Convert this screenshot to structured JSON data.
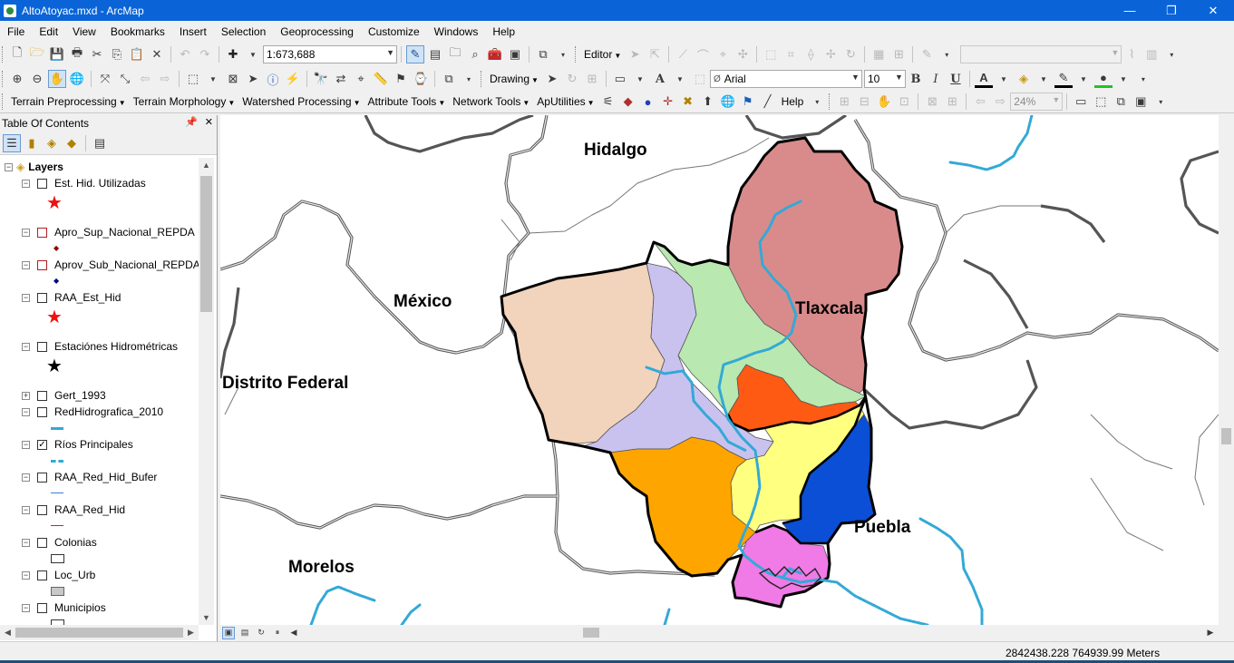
{
  "window": {
    "title": "AltoAtoyac.mxd - ArcMap",
    "controls": [
      "—",
      "❐",
      "✕"
    ]
  },
  "menu": [
    "File",
    "Edit",
    "View",
    "Bookmarks",
    "Insert",
    "Selection",
    "Geoprocessing",
    "Customize",
    "Windows",
    "Help"
  ],
  "toolbar1": {
    "scale": "1:673,688",
    "editor_label": "Editor"
  },
  "toolbar2": {
    "drawing_label": "Drawing",
    "font_name": "Arial",
    "font_size": "10",
    "bold": "B",
    "italic": "I",
    "underline": "U",
    "text_tool": "A"
  },
  "toolbar3": {
    "items": [
      "Terrain Preprocessing",
      "Terrain Morphology",
      "Watershed Processing",
      "Attribute Tools",
      "Network Tools",
      "ApUtilities"
    ],
    "help_label": "Help",
    "zoom_percent": "24%"
  },
  "toc": {
    "title": "Table Of Contents",
    "root": "Layers",
    "layers": [
      {
        "name": "Est. Hid. Utilizadas",
        "expanded": true,
        "checked": false,
        "symbol": "star-red"
      },
      {
        "name": "Apro_Sup_Nacional_REPDA",
        "expanded": true,
        "checked": false,
        "symbol": "dot-darkred"
      },
      {
        "name": "Aprov_Sub_Nacional_REPDA",
        "expanded": true,
        "checked": false,
        "symbol": "dot-navy"
      },
      {
        "name": "RAA_Est_Hid",
        "expanded": true,
        "checked": false,
        "symbol": "star-red"
      },
      {
        "name": "Estaciónes Hidrométricas",
        "expanded": true,
        "checked": false,
        "symbol": "star-black"
      },
      {
        "name": "Gert_1993",
        "expanded": false,
        "checked": false,
        "symbol": "none"
      },
      {
        "name": "RedHidrografica_2010",
        "expanded": true,
        "checked": false,
        "symbol": "line-cyan"
      },
      {
        "name": "Ríos Principales",
        "expanded": true,
        "checked": true,
        "symbol": "line-cyan-dashed"
      },
      {
        "name": "RAA_Red_Hid_Bufer",
        "expanded": true,
        "checked": false,
        "symbol": "line-blue"
      },
      {
        "name": "RAA_Red_Hid",
        "expanded": true,
        "checked": false,
        "symbol": "line-red"
      },
      {
        "name": "Colonias",
        "expanded": true,
        "checked": false,
        "symbol": "poly-white"
      },
      {
        "name": "Loc_Urb",
        "expanded": true,
        "checked": false,
        "symbol": "poly-gray"
      },
      {
        "name": "Municipios",
        "expanded": true,
        "checked": false,
        "symbol": "poly-white"
      }
    ]
  },
  "map": {
    "labels": [
      "Hidalgo",
      "México",
      "Tlaxcala",
      "Distrito Federal",
      "Puebla",
      "Morelos"
    ],
    "subbasin_colors": [
      "#d98b8b",
      "#f2d3bb",
      "#c9c2ef",
      "#b9e8b0",
      "#ff5a14",
      "#ffff80",
      "#ffa500",
      "#0a4fd6",
      "#f07ae6"
    ],
    "river_color": "#33a9d6"
  },
  "status": {
    "coordinates": "2842438.228  764939.99 Meters"
  }
}
